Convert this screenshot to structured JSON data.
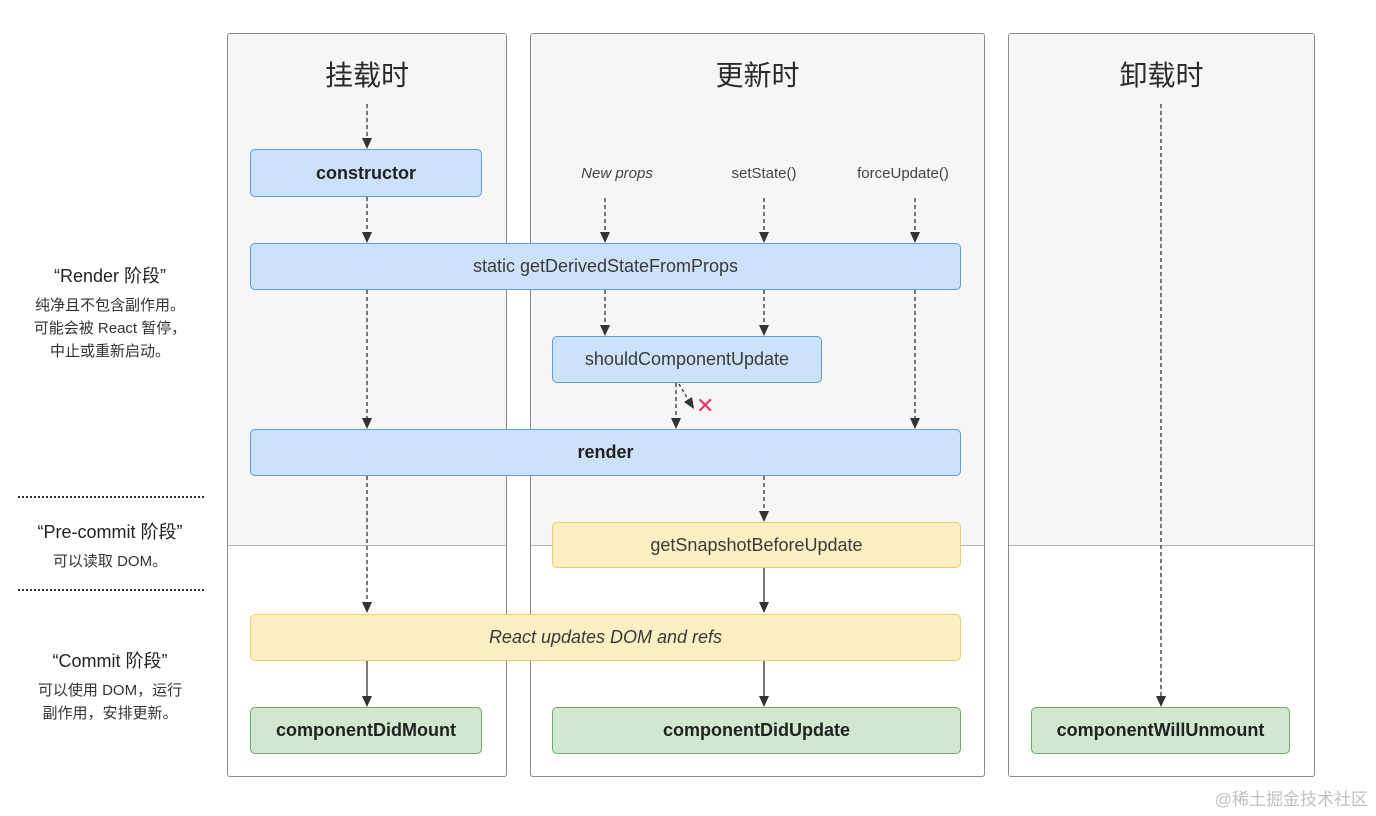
{
  "phases": [
    {
      "title": "“Render 阶段”",
      "description": [
        "纯净且不包含副作用。",
        "可能会被 React 暂停，",
        "中止或重新启动。"
      ]
    },
    {
      "title": "“Pre-commit 阶段”",
      "description": [
        "可以读取 DOM。"
      ]
    },
    {
      "title": "“Commit 阶段”",
      "description": [
        "可以使用 DOM，运行",
        "副作用，安排更新。"
      ]
    }
  ],
  "columns": {
    "mounting": {
      "title": "挂载时"
    },
    "updating": {
      "title": "更新时"
    },
    "unmounting": {
      "title": "卸载时"
    }
  },
  "triggers": {
    "new_props": "New props",
    "set_state": "setState()",
    "force_update": "forceUpdate()"
  },
  "methods": {
    "constructor": "constructor",
    "get_derived_state_from_props": "static getDerivedStateFromProps",
    "should_component_update": "shouldComponentUpdate",
    "render": "render",
    "get_snapshot_before_update": "getSnapshotBeforeUpdate",
    "react_updates_dom": "React updates DOM and refs",
    "component_did_mount": "componentDidMount",
    "component_did_update": "componentDidUpdate",
    "component_will_unmount": "componentWillUnmount"
  },
  "cancel_marker": "✕",
  "watermark": "@稀土掘金技术社区",
  "colors": {
    "render_phase": "#cce2fb",
    "precommit_phase": "#fcefc4",
    "commit_phase": "#d1e7cf",
    "cancel": "#e8336d"
  }
}
